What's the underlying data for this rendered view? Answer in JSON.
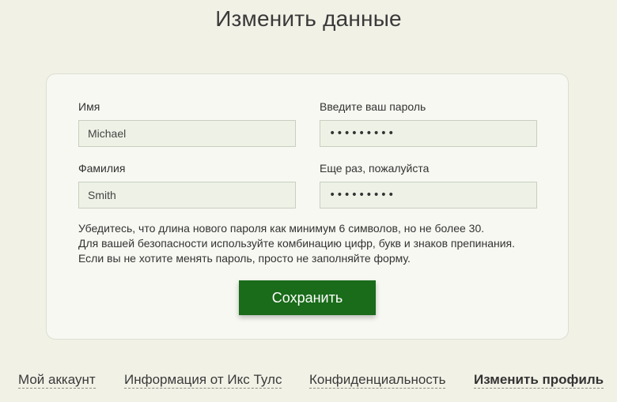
{
  "page": {
    "title": "Изменить данные"
  },
  "form": {
    "first_name": {
      "label": "Имя",
      "value": "Michael"
    },
    "last_name": {
      "label": "Фамилия",
      "value": "Smith"
    },
    "password": {
      "label": "Введите ваш пароль",
      "value": "•••••••••"
    },
    "password_confirm": {
      "label": "Еще раз, пожалуйста",
      "value": "•••••••••"
    },
    "hint_lines": [
      "Убедитесь, что длина нового пароля как минимум 6 символов, но не более 30.",
      "Для вашей безопасности используйте комбинацию цифр, букв и знаков препинания.",
      "Если вы не хотите менять пароль, просто не заполняйте форму."
    ],
    "save_label": "Сохранить"
  },
  "bottom_nav": {
    "items": [
      {
        "label": "Мой аккаунт",
        "active": false
      },
      {
        "label": "Информация от Икс Тулс",
        "active": false
      },
      {
        "label": "Конфиденциальность",
        "active": false
      },
      {
        "label": "Изменить профиль",
        "active": true
      }
    ]
  },
  "colors": {
    "background": "#f1f1e6",
    "card": "#f7f8f2",
    "input_bg": "#eef2e6",
    "accent_button": "#1a6b1a"
  }
}
